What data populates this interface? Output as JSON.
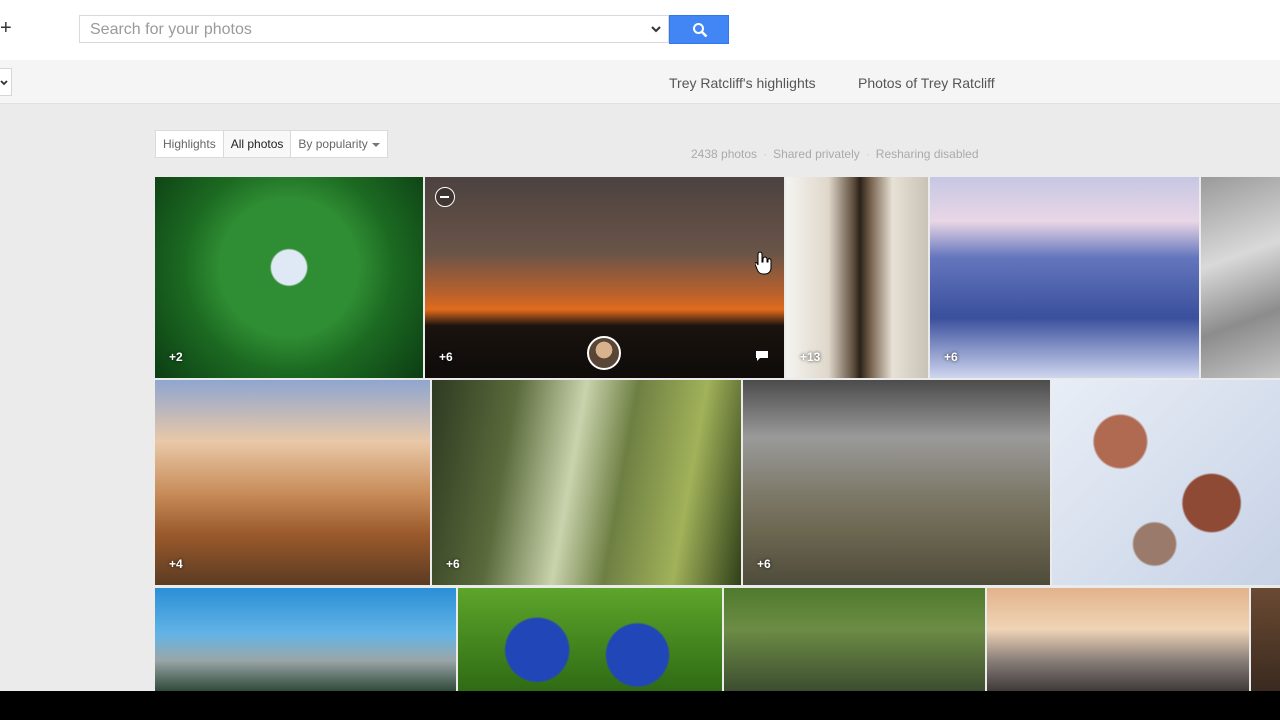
{
  "toolbar": {
    "plus_label": "+",
    "search_placeholder": "Search for your photos"
  },
  "subnav": {
    "links": [
      "Trey Ratcliff's highlights",
      "Photos of Trey Ratcliff"
    ]
  },
  "filters": {
    "highlights": "Highlights",
    "all_photos": "All photos",
    "sort": "By popularity"
  },
  "meta": {
    "count": "2438 photos",
    "sharing": "Shared privately",
    "resharing": "Resharing disabled"
  },
  "photos": [
    {
      "count": "+2"
    },
    {
      "count": "+6"
    },
    {
      "count": "+13"
    },
    {
      "count": "+6"
    },
    {
      "count": ""
    },
    {
      "count": "+4"
    },
    {
      "count": "+6"
    },
    {
      "count": "+6"
    },
    {
      "count": ""
    },
    {
      "count": ""
    },
    {
      "count": ""
    },
    {
      "count": ""
    },
    {
      "count": ""
    }
  ],
  "colors": {
    "accent": "#4285f4",
    "background": "#ebebeb"
  }
}
